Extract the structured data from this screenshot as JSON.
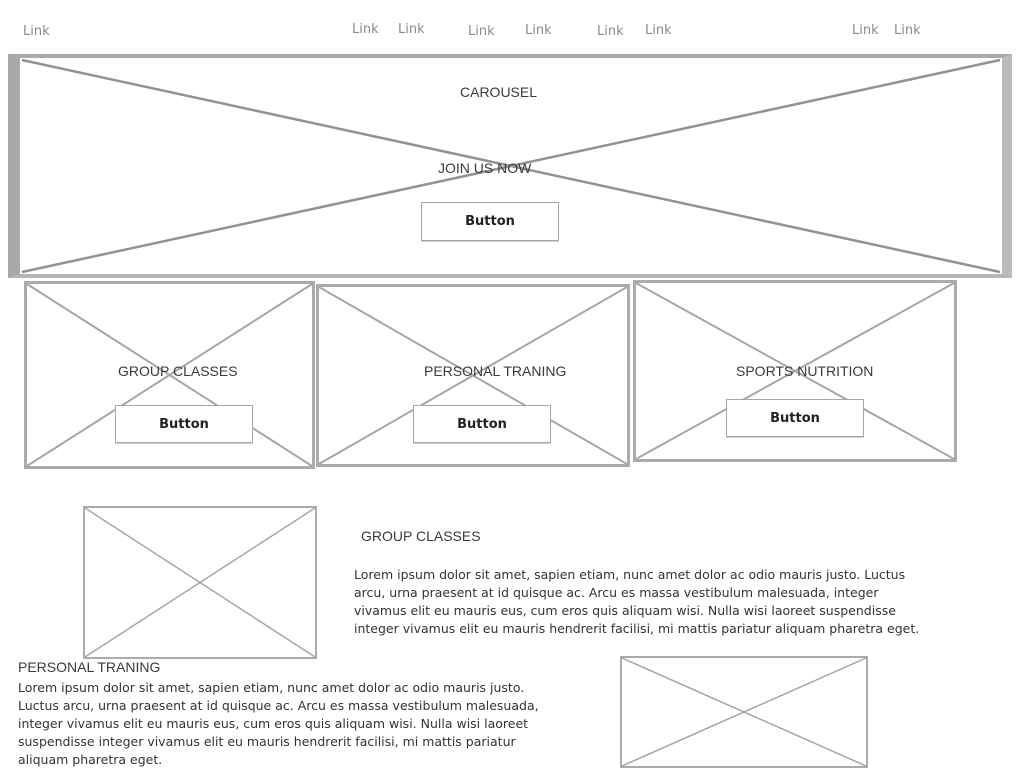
{
  "nav": {
    "links": [
      "Link",
      "Link",
      "Link",
      "Link",
      "Link",
      "Link",
      "Link",
      "Link",
      "Link"
    ]
  },
  "hero": {
    "carousel_label": "CAROUSEL",
    "cta_heading": "JOIN US NOW",
    "button_label": "Button"
  },
  "cards": [
    {
      "title": "GROUP CLASSES",
      "button_label": "Button"
    },
    {
      "title": "PERSONAL TRANING",
      "button_label": "Button"
    },
    {
      "title": "SPORTS NUTRITION",
      "button_label": "Button"
    }
  ],
  "sections": [
    {
      "heading": "GROUP CLASSES",
      "body": "Lorem ipsum dolor sit amet, sapien etiam, nunc amet dolor ac odio mauris justo. Luctus arcu, urna praesent at id quisque ac. Arcu es massa vestibulum malesuada, integer vivamus elit eu mauris eus, cum eros quis aliquam wisi. Nulla wisi laoreet suspendisse integer vivamus elit eu mauris hendrerit facilisi, mi mattis pariatur aliquam pharetra eget."
    },
    {
      "heading": "PERSONAL TRANING",
      "body": "Lorem ipsum dolor sit amet, sapien etiam, nunc amet dolor ac odio mauris justo. Luctus arcu, urna praesent at id quisque ac. Arcu es massa vestibulum malesuada, integer vivamus elit eu mauris eus, cum eros quis aliquam wisi. Nulla wisi laoreet suspendisse integer vivamus elit eu mauris hendrerit facilisi, mi mattis pariatur aliquam pharetra eget."
    }
  ]
}
